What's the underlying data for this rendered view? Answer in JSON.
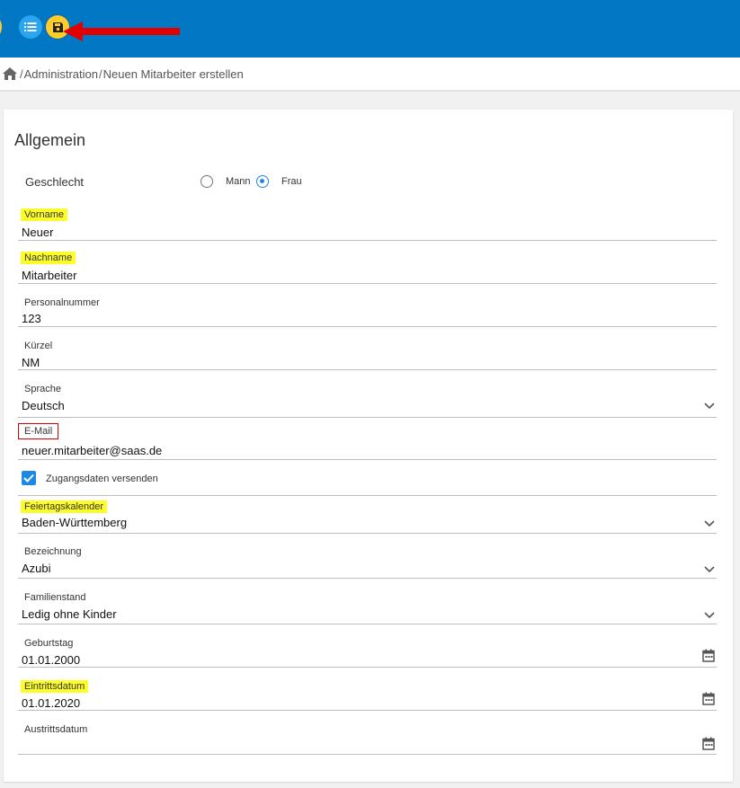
{
  "toolbar": {
    "list_icon": "list-icon",
    "save_icon": "floppy-disk-icon",
    "accent_color": "#0277c4",
    "save_color": "#ffcc29"
  },
  "breadcrumb": {
    "home_icon": "home-icon",
    "separator": "/",
    "items": [
      "Administration",
      "Neuen Mitarbeiter erstellen"
    ]
  },
  "form": {
    "title": "Allgemein",
    "gender": {
      "label": "Geschlecht",
      "options": [
        "Mann",
        "Frau"
      ],
      "selected": "Frau"
    },
    "vorname": {
      "label": "Vorname",
      "value": "Neuer"
    },
    "nachname": {
      "label": "Nachname",
      "value": "Mitarbeiter"
    },
    "personalnummer": {
      "label": "Personalnummer",
      "value": "123"
    },
    "kuerzel": {
      "label": "Kürzel",
      "value": "NM"
    },
    "sprache": {
      "label": "Sprache",
      "value": "Deutsch"
    },
    "email": {
      "label": "E-Mail",
      "value": "neuer.mitarbeiter@saas.de"
    },
    "zugangsdaten": {
      "label": "Zugangsdaten versenden",
      "checked": true
    },
    "feiertagskalender": {
      "label": "Feiertagskalender",
      "value": "Baden-Württemberg"
    },
    "bezeichnung": {
      "label": "Bezeichnung",
      "value": "Azubi"
    },
    "familienstand": {
      "label": "Familienstand",
      "value": "Ledig ohne Kinder"
    },
    "geburtstag": {
      "label": "Geburtstag",
      "value": "01.01.2000"
    },
    "eintrittsdatum": {
      "label": "Eintrittsdatum",
      "value": "01.01.2020"
    },
    "austrittsdatum": {
      "label": "Austrittsdatum",
      "value": ""
    }
  },
  "colors": {
    "highlight": "#fdfd29",
    "annotation_red": "#e00000",
    "checkbox_blue": "#1e88e5"
  }
}
